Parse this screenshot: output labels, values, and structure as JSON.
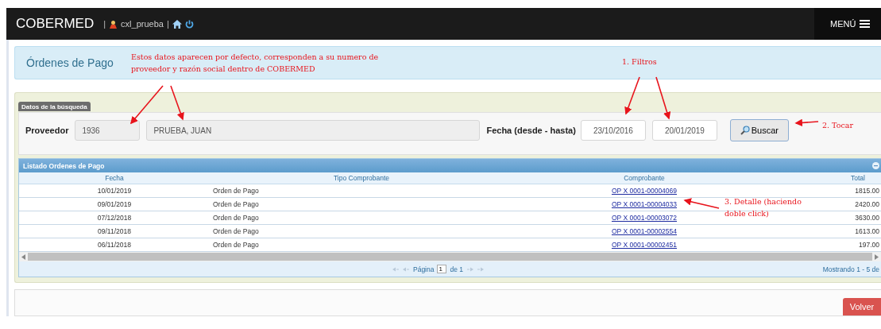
{
  "navbar": {
    "brand": "COBERMED",
    "separator_left": "|",
    "user": "cxl_prueba",
    "separator_right": "|",
    "menu": "MENÚ"
  },
  "info_panel": {
    "title": "Órdenes de Pago"
  },
  "search": {
    "legend": "Datos de la búsqueda",
    "provider_label": "Proveedor",
    "provider_number": "1936",
    "provider_name": "PRUEBA, JUAN",
    "date_label": "Fecha (desde - hasta)",
    "date_from": "23/10/2016",
    "date_to": "20/01/2019",
    "search_button": "Buscar"
  },
  "grid": {
    "title": "Listado Ordenes de Pago",
    "columns": [
      "Fecha",
      "Tipo Comprobante",
      "Comprobante",
      "Total"
    ],
    "rows": [
      {
        "date": "10/01/2019",
        "type": "Orden de Pago",
        "voucher": "OP X 0001-00004069",
        "total": "1815.00"
      },
      {
        "date": "09/01/2019",
        "type": "Orden de Pago",
        "voucher": "OP X 0001-00004033",
        "total": "2420.00"
      },
      {
        "date": "07/12/2018",
        "type": "Orden de Pago",
        "voucher": "OP X 0001-00003072",
        "total": "3630.00"
      },
      {
        "date": "09/11/2018",
        "type": "Orden de Pago",
        "voucher": "OP X 0001-00002554",
        "total": "1613.00"
      },
      {
        "date": "06/11/2018",
        "type": "Orden de Pago",
        "voucher": "OP X 0001-00002451",
        "total": "197.00"
      }
    ],
    "pager": {
      "page_label": "Página",
      "page": "1",
      "of_label": "de 1",
      "showing": "Mostrando 1 - 5 de"
    }
  },
  "footer": {
    "back_button": "Volver"
  },
  "annotations": [
    {
      "text": "Estos datos aparecen por defecto, corresponden a su numero de proveedor y razón social dentro de COBERMED"
    },
    {
      "text": "1. Filtros"
    },
    {
      "text": "2. Tocar"
    },
    {
      "text": "3. Detalle (haciendo doble click)"
    }
  ]
}
